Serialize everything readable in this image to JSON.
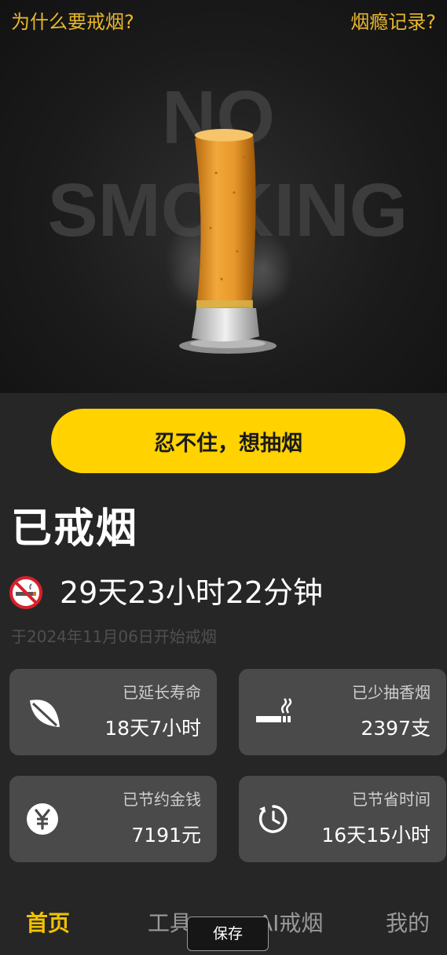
{
  "header": {
    "why_quit_link": "为什么要戒烟?",
    "craving_log_link": "烟瘾记录?"
  },
  "hero": {
    "poster_line1": "NO",
    "poster_line2": "SMOKING"
  },
  "craving_button_label": "忍不住，想抽烟",
  "status": {
    "title": "已戒烟",
    "duration": "29天23小时22分钟",
    "start_note": "于2024年11月06日开始戒烟"
  },
  "stats": [
    {
      "label": "已延长寿命",
      "value": "18天7小时",
      "icon": "leaf-icon"
    },
    {
      "label": "已少抽香烟",
      "value": "2397支",
      "icon": "cigarette-icon"
    },
    {
      "label": "已节约金钱",
      "value": "7191元",
      "icon": "yuan-coin-icon"
    },
    {
      "label": "已节省时间",
      "value": "16天15小时",
      "icon": "timer-icon"
    }
  ],
  "tabs": [
    {
      "label": "首页",
      "active": true
    },
    {
      "label": "工具",
      "active": false
    },
    {
      "label": "AI戒烟",
      "active": false
    },
    {
      "label": "我的",
      "active": false
    }
  ],
  "save_toast": "保存",
  "colors": {
    "accent_yellow": "#ffd200",
    "link_gold": "#e8b82c",
    "card_bg": "#4a4a4a",
    "page_bg": "#262626"
  }
}
